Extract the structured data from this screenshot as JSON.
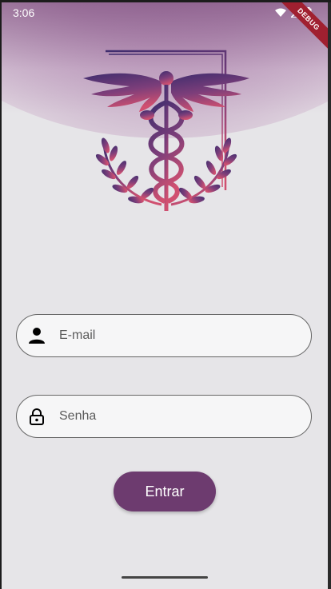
{
  "status_bar": {
    "time": "3:06",
    "icons": [
      "wifi-icon",
      "signal-icon",
      "battery-icon"
    ],
    "debug_label": "DEBUG"
  },
  "logo": {
    "icon": "caduceus-logo",
    "colors": [
      "#4b2e6f",
      "#c8506f"
    ]
  },
  "form": {
    "email": {
      "placeholder": "E-mail",
      "icon": "person-icon"
    },
    "password": {
      "placeholder": "Senha",
      "icon": "lock-icon"
    },
    "submit_label": "Entrar"
  },
  "colors": {
    "accent": "#6d3b6f",
    "background": "#e6e5e8"
  }
}
